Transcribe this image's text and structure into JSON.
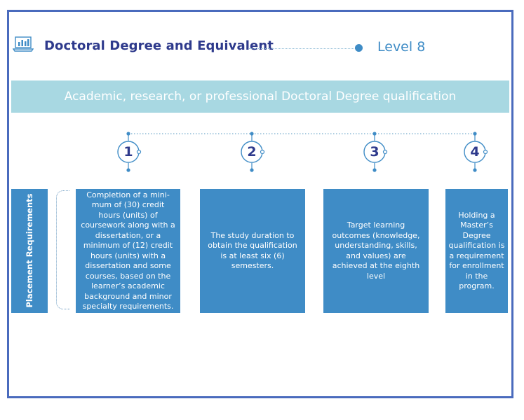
{
  "header": {
    "title": "Doctoral Degree and Equivalent",
    "level": "Level 8",
    "icon": "laptop-chart-icon"
  },
  "banner": {
    "text": "Academic, research, or professional Doctoral Degree qualification"
  },
  "side_label": "Placement Requirements",
  "steps": [
    {
      "number": "1",
      "text": "Completion of a mini-mum of (30) credit hours (units) of coursework along with a dissertation, or a minimum of (12) credit hours (units) with a dissertation and some courses, based on the learner’s academic background and minor specialty requirements."
    },
    {
      "number": "2",
      "text": "The study duration to obtain the qualification is at least six (6) semesters."
    },
    {
      "number": "3",
      "text": "Target learning outcomes (knowledge, understanding, skills, and values) are achieved at the eighth level"
    },
    {
      "number": "4",
      "text": "Holding a Master’s Degree qualification is a requirement for enrollment in the program."
    }
  ],
  "colors": {
    "frame_border": "#4a6bbd",
    "title": "#2e3a8c",
    "accent_blue": "#3f8cc6",
    "banner": "#a8d8e2"
  }
}
